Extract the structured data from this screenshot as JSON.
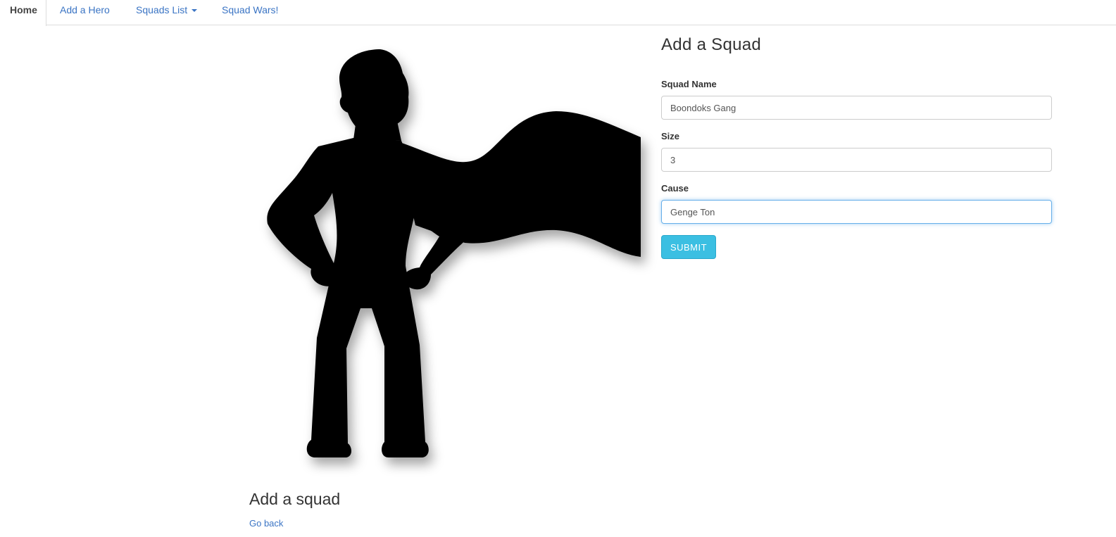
{
  "nav": {
    "tabs": [
      {
        "label": "Home",
        "active": true
      },
      {
        "label": "Add a Hero",
        "active": false
      },
      {
        "label": "Squads List",
        "active": false,
        "dropdown": true
      },
      {
        "label": "Squad Wars!",
        "active": false
      }
    ]
  },
  "hero_image": {
    "icon": "superhero-silhouette-icon",
    "color": "#000000"
  },
  "form": {
    "title": "Add a Squad",
    "fields": [
      {
        "label": "Squad Name",
        "value": "Boondoks Gang"
      },
      {
        "label": "Size",
        "value": "3"
      },
      {
        "label": "Cause",
        "value": "Genge Ton",
        "focused": true
      }
    ],
    "submit_label": "SUBMIT"
  },
  "footer": {
    "title": "Add a squad",
    "back_link": "Go back"
  },
  "colors": {
    "link": "#3a74c4",
    "submit": "#3bbfe2",
    "focus_border": "#66afe9"
  }
}
